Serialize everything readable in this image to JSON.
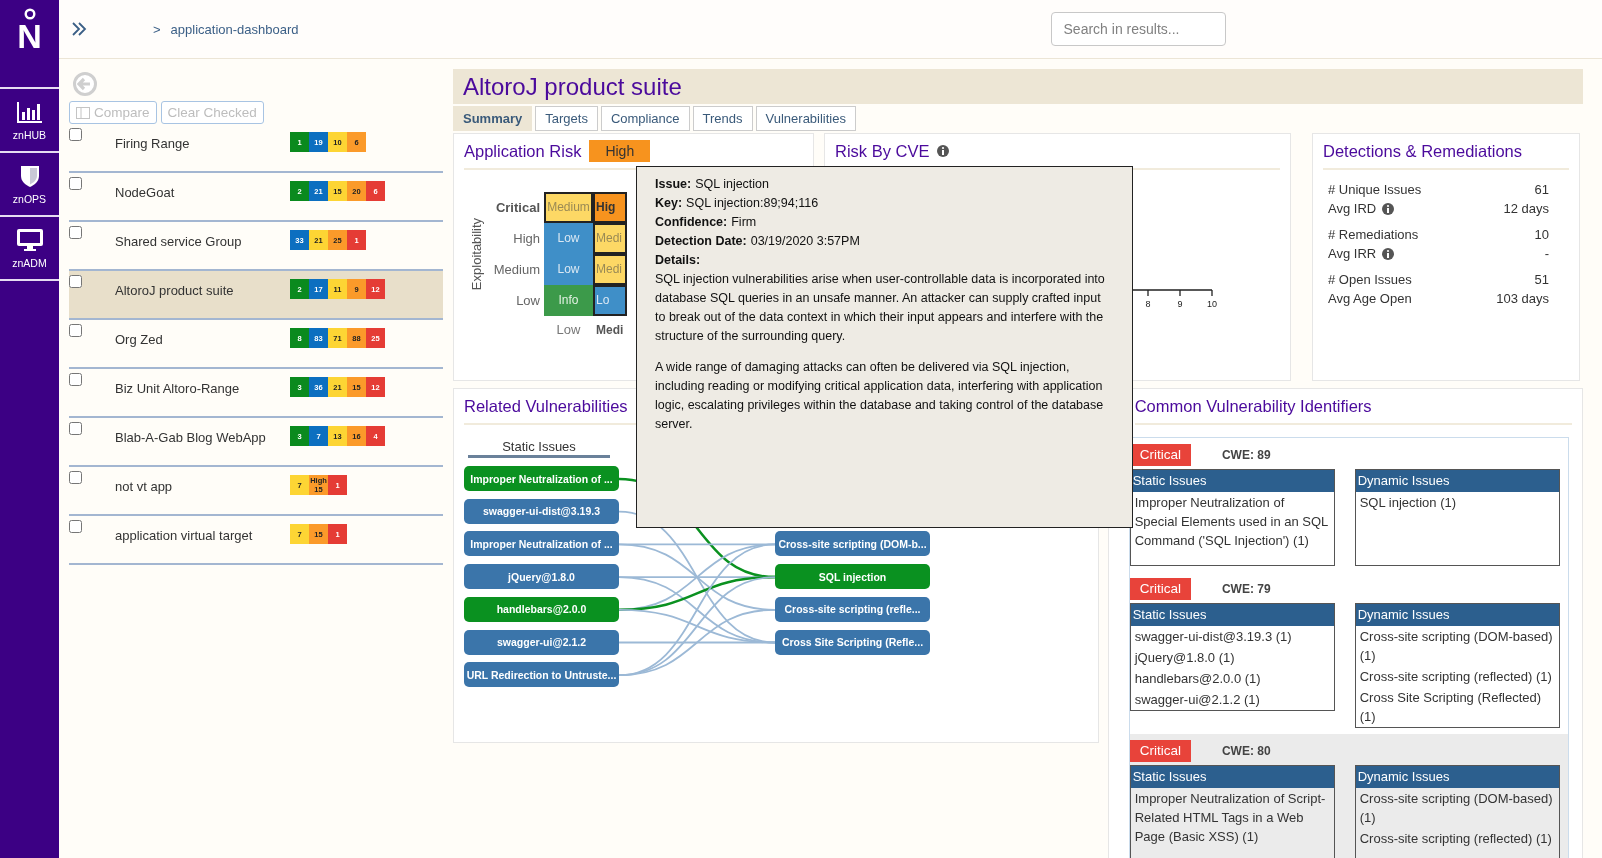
{
  "nav": {
    "logo": "N",
    "items": [
      {
        "label": "znHUB",
        "kind": "hub"
      },
      {
        "label": "znOPS",
        "kind": "ops"
      },
      {
        "label": "znADM",
        "kind": "adm"
      }
    ]
  },
  "header": {
    "separator": ">",
    "breadcrumb": "application-dashboard",
    "search": {
      "placeholder": "Search in results..."
    }
  },
  "sidebar": {
    "actions": [
      {
        "label": "Compare",
        "kind": "compare",
        "disabled": true
      },
      {
        "label": "Clear Checked",
        "kind": "clear",
        "disabled": true
      }
    ],
    "items": [
      {
        "name": "Firing Range",
        "checked": false,
        "selected": false,
        "counts": [
          {
            "value": "1",
            "color": "#0a8a1e"
          },
          {
            "value": "19",
            "color": "#0c6fc0"
          },
          {
            "value": "10",
            "color": "#fdd534"
          },
          {
            "value": "6",
            "color": "#fb9a2a"
          }
        ]
      },
      {
        "name": "NodeGoat",
        "checked": false,
        "selected": false,
        "counts": [
          {
            "value": "2",
            "color": "#0a8a1e"
          },
          {
            "value": "21",
            "color": "#0c6fc0"
          },
          {
            "value": "15",
            "color": "#fdd534"
          },
          {
            "value": "20",
            "color": "#fb9a2a"
          },
          {
            "value": "6",
            "color": "#e53c35"
          }
        ]
      },
      {
        "name": "Shared service Group",
        "checked": false,
        "selected": false,
        "counts": [
          {
            "value": "33",
            "color": "#0c6fc0"
          },
          {
            "value": "21",
            "color": "#fdd534"
          },
          {
            "value": "25",
            "color": "#fb9a2a"
          },
          {
            "value": "1",
            "color": "#e53c35"
          }
        ]
      },
      {
        "name": "AltoroJ product suite",
        "checked": false,
        "selected": true,
        "counts": [
          {
            "value": "2",
            "color": "#0a8a1e"
          },
          {
            "value": "17",
            "color": "#0c6fc0"
          },
          {
            "value": "11",
            "color": "#fdd534"
          },
          {
            "value": "9",
            "color": "#fb9a2a"
          },
          {
            "value": "12",
            "color": "#e53c35"
          }
        ]
      },
      {
        "name": "Org Zed",
        "checked": false,
        "selected": false,
        "counts": [
          {
            "value": "8",
            "color": "#0a8a1e"
          },
          {
            "value": "83",
            "color": "#0c6fc0"
          },
          {
            "value": "71",
            "color": "#fdd534"
          },
          {
            "value": "88",
            "color": "#fb9a2a"
          },
          {
            "value": "25",
            "color": "#e53c35"
          }
        ]
      },
      {
        "name": "Biz Unit Altoro-Range",
        "checked": false,
        "selected": false,
        "counts": [
          {
            "value": "3",
            "color": "#0a8a1e"
          },
          {
            "value": "36",
            "color": "#0c6fc0"
          },
          {
            "value": "21",
            "color": "#fdd534"
          },
          {
            "value": "15",
            "color": "#fb9a2a"
          },
          {
            "value": "12",
            "color": "#e53c35"
          }
        ]
      },
      {
        "name": "Blab-A-Gab Blog WebApp",
        "checked": false,
        "selected": false,
        "counts": [
          {
            "value": "3",
            "color": "#0a8a1e"
          },
          {
            "value": "7",
            "color": "#0c6fc0"
          },
          {
            "value": "13",
            "color": "#fdd534"
          },
          {
            "value": "16",
            "color": "#fb9a2a"
          },
          {
            "value": "4",
            "color": "#e53c35"
          }
        ]
      },
      {
        "name": "not vt app",
        "checked": false,
        "selected": false,
        "counts": [
          {
            "value": "7",
            "color": "#fdd534"
          },
          {
            "value": "High 15",
            "color": "#fb9a2a"
          },
          {
            "value": "1",
            "color": "#e53c35"
          }
        ]
      },
      {
        "name": "application virtual target",
        "checked": false,
        "selected": false,
        "counts": [
          {
            "value": "7",
            "color": "#fdd534"
          },
          {
            "value": "15",
            "color": "#fb9a2a"
          },
          {
            "value": "1",
            "color": "#e53c35"
          }
        ]
      }
    ]
  },
  "title": "AltoroJ product suite",
  "tabs": [
    {
      "label": "Summary",
      "selected": true
    },
    {
      "label": "Targets",
      "selected": false
    },
    {
      "label": "Compliance",
      "selected": false
    },
    {
      "label": "Trends",
      "selected": false
    },
    {
      "label": "Vulnerabilities",
      "selected": false
    }
  ],
  "application_risk": {
    "title": "Application Risk",
    "rating": "High",
    "axis_label": "Exploitability",
    "rows": [
      {
        "label": "Critical",
        "emphasized": true,
        "cells": [
          {
            "text": "Medium",
            "kind": "medium",
            "outlined": true,
            "emphasized": false
          },
          {
            "text": "Hig",
            "kind": "high",
            "outlined": true,
            "emphasized": true
          }
        ]
      },
      {
        "label": "High",
        "emphasized": false,
        "cells": [
          {
            "text": "Low",
            "kind": "low",
            "outlined": false,
            "emphasized": false
          },
          {
            "text": "Medi",
            "kind": "medium",
            "outlined": true,
            "emphasized": false
          }
        ]
      },
      {
        "label": "Medium",
        "emphasized": false,
        "cells": [
          {
            "text": "Low",
            "kind": "low",
            "outlined": false,
            "emphasized": false
          },
          {
            "text": "Medi",
            "kind": "medium",
            "outlined": true,
            "emphasized": false
          }
        ]
      },
      {
        "label": "Low",
        "emphasized": false,
        "cells": [
          {
            "text": "Info",
            "kind": "info",
            "outlined": false,
            "emphasized": false
          },
          {
            "text": "Lo",
            "kind": "low",
            "outlined": true,
            "emphasized": false
          }
        ]
      }
    ],
    "x_axis_labels": [
      {
        "label": "Low",
        "emphasized": false
      },
      {
        "label": "Medi",
        "emphasized": true
      }
    ]
  },
  "risk_by_cve": {
    "title": "Risk By CVE",
    "info": true,
    "ticks": [
      "8",
      "9",
      "10"
    ]
  },
  "detections": {
    "title": "Detections & Remediations",
    "groups": [
      {
        "rows": [
          {
            "label": "# Unique Issues",
            "value": "61"
          },
          {
            "label": "Avg IRD",
            "value": "12 days",
            "info": true
          }
        ]
      },
      {
        "rows": [
          {
            "label": "# Remediations",
            "value": "10"
          },
          {
            "label": "Avg IRR",
            "value": "-",
            "info": true
          }
        ]
      },
      {
        "rows": [
          {
            "label": "# Open Issues",
            "value": "51"
          },
          {
            "label": "Avg Age Open",
            "value": "103 days"
          }
        ]
      }
    ]
  },
  "related": {
    "title": "Related Vulnerabilities",
    "static_header": "Static Issues",
    "static_nodes": [
      {
        "label": "Improper Neutralization of ...",
        "selected": true
      },
      {
        "label": "swagger-ui-dist@3.19.3",
        "selected": false
      },
      {
        "label": "Improper Neutralization of ...",
        "selected": false
      },
      {
        "label": "jQuery@1.8.0",
        "selected": false
      },
      {
        "label": "handlebars@2.0.0",
        "selected": true
      },
      {
        "label": "swagger-ui@2.1.2",
        "selected": false
      },
      {
        "label": "URL Redirection to Untruste...",
        "selected": false
      }
    ],
    "dynamic_nodes": [
      {
        "label": "Cross-site scripting (DOM-b...",
        "selected": false
      },
      {
        "label": "SQL injection",
        "selected": true
      },
      {
        "label": "Cross-site scripting (refle...",
        "selected": false
      },
      {
        "label": "Cross Site Scripting (Refle...",
        "selected": false
      }
    ]
  },
  "tooltip": {
    "fields": [
      {
        "label": "Issue:",
        "value": "SQL injection"
      },
      {
        "label": "Key:",
        "value": "SQL injection:89;94;116"
      },
      {
        "label": "Confidence:",
        "value": "Firm"
      },
      {
        "label": "Detection Date:",
        "value": "03/19/2020 3:57PM"
      }
    ],
    "details_label": "Details:",
    "paragraphs": [
      "SQL injection vulnerabilities arise when user-controllable data is incorporated into database SQL queries in an unsafe manner. An attacker can supply crafted input to break out of the data context in which their input appears and interfere with the structure of the surrounding query.",
      "A wide range of damaging attacks can often be delivered via SQL injection, including reading or modifying critical application data, interfering with application logic, escalating privileges within the database and taking control of the database server."
    ]
  },
  "cvi": {
    "title": "Common Vulnerability Identifiers",
    "entries": [
      {
        "severity": "Critical",
        "color": "#e8433a",
        "cwe": "CWE: 89",
        "highlighted": false,
        "static_header": "Static Issues",
        "static_items": [
          "Improper Neutralization of Special Elements used in an SQL Command ('SQL Injection') (1)"
        ],
        "dynamic_header": "Dynamic Issues",
        "dynamic_items": [
          "SQL injection (1)"
        ]
      },
      {
        "severity": "Critical",
        "color": "#e8433a",
        "cwe": "CWE: 79",
        "highlighted": false,
        "static_header": "Static Issues",
        "static_items": [
          "swagger-ui-dist@3.19.3 (1)",
          "jQuery@1.8.0 (1)",
          "handlebars@2.0.0 (1)",
          "swagger-ui@2.1.2 (1)"
        ],
        "dynamic_header": "Dynamic Issues",
        "dynamic_items": [
          "Cross-site scripting (DOM-based) (1)",
          "Cross-site scripting (reflected) (1)",
          "Cross Site Scripting (Reflected) (1)"
        ]
      },
      {
        "severity": "Critical",
        "color": "#e8433a",
        "cwe": "CWE: 80",
        "highlighted": true,
        "static_header": "Static Issues",
        "static_items": [
          "Improper Neutralization of Script-Related HTML Tags in a Web Page (Basic XSS) (1)"
        ],
        "dynamic_header": "Dynamic Issues",
        "dynamic_items": [
          "Cross-site scripting (DOM-based) (1)",
          "Cross-site scripting (reflected) (1)"
        ]
      }
    ]
  }
}
